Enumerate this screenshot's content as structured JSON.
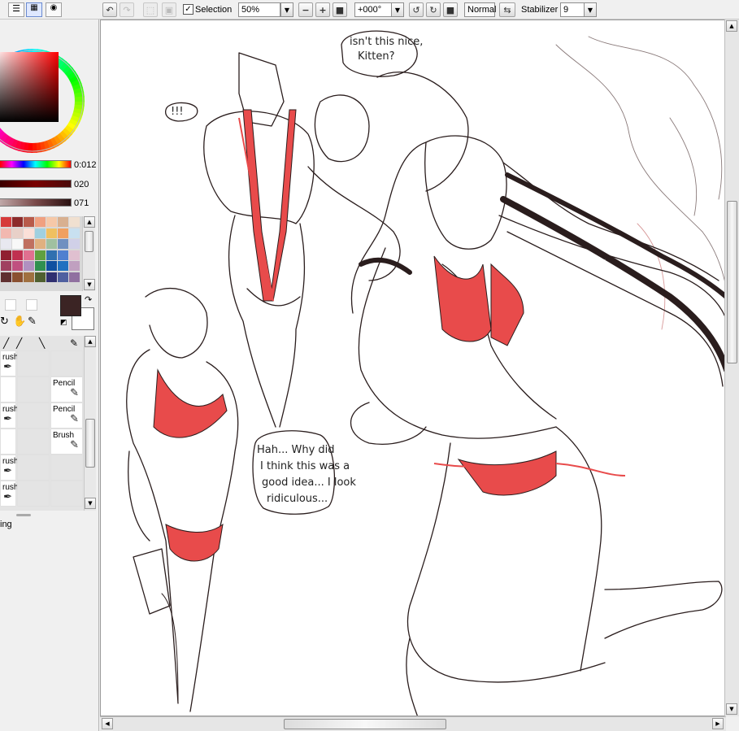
{
  "toolbar": {
    "selection_label": "Selection",
    "selection_checked": true,
    "zoom_value": "50%",
    "rotation_value": "+000°",
    "blend_mode": "Normal",
    "stabilizer_label": "Stabilizer",
    "stabilizer_value": "9"
  },
  "color_panel": {
    "current_color": "#3b2424",
    "background_color": "#ffffff",
    "sliders": [
      {
        "value": "0:012"
      },
      {
        "value": "020"
      },
      {
        "value": "071"
      }
    ]
  },
  "swatches": [
    "#d63a3a",
    "#8c2b2b",
    "#b85a4a",
    "#f0a080",
    "#f6c8a8",
    "#d8b090",
    "#f0e0d0",
    "#f2b8b0",
    "#e8d0c8",
    "#fbe0d8",
    "#a0d0e0",
    "#f0c060",
    "#f0a060",
    "#c8e0f0",
    "#e8e8f0",
    "#f8f8f8",
    "#c07060",
    "#e0b080",
    "#a0c0a0",
    "#7090c0",
    "#d0d0e8",
    "#902030",
    "#c03050",
    "#e07090",
    "#60a040",
    "#3070b0",
    "#5080d0",
    "#e0c0d0",
    "#a04060",
    "#c05080",
    "#b090c0",
    "#309050",
    "#1050a0",
    "#2070c0",
    "#c0a0c0",
    "#603030",
    "#8a5030",
    "#a07040",
    "#506030",
    "#303070",
    "#5060a0",
    "#9070a0"
  ],
  "brush_list": {
    "rows": [
      {
        "left": "rush",
        "right": ""
      },
      {
        "left": "",
        "right": "Pencil"
      },
      {
        "left": "rush",
        "right": "Pencil"
      },
      {
        "left": "",
        "right": "Brush"
      },
      {
        "left": "rush",
        "right": ""
      },
      {
        "left": "rush",
        "right": ""
      }
    ],
    "footer_text": "ing"
  },
  "canvas": {
    "bubble_top": [
      "isn't this nice,",
      "Kitten?"
    ],
    "bubble_small": "!!!",
    "bubble_main": [
      "Hah... Why did",
      "I think this was a",
      "good idea... I look",
      "ridiculous..."
    ]
  }
}
